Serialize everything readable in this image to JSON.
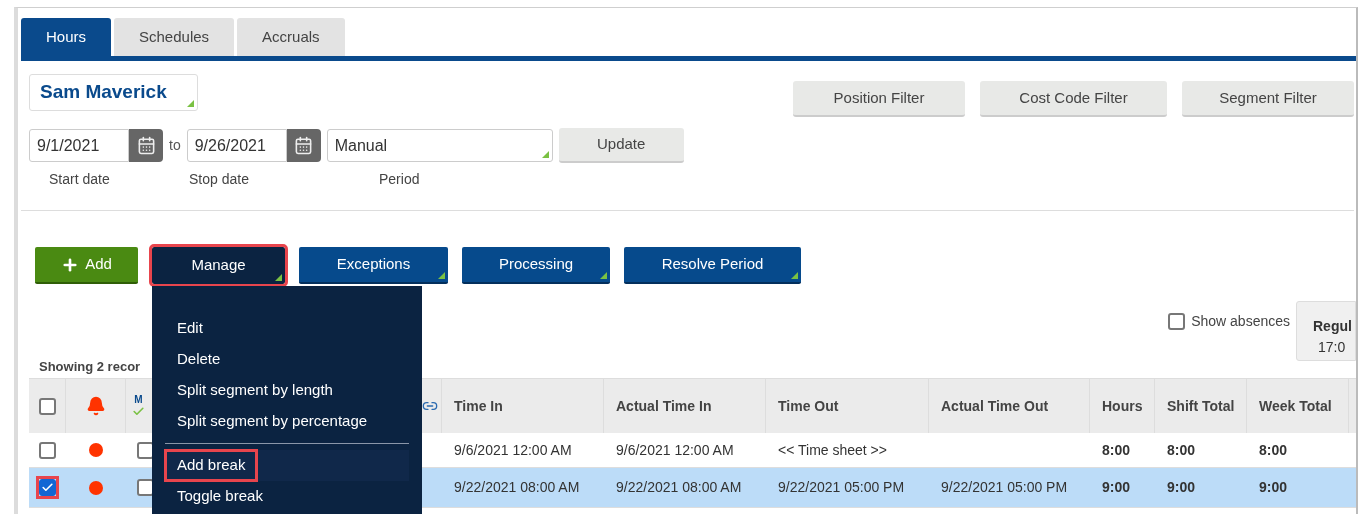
{
  "tabs": [
    {
      "label": "Hours",
      "selected": true
    },
    {
      "label": "Schedules",
      "selected": false
    },
    {
      "label": "Accruals",
      "selected": false
    }
  ],
  "employee": {
    "name": "Sam Maverick"
  },
  "filters": [
    "Position Filter",
    "Cost Code Filter",
    "Segment Filter"
  ],
  "range": {
    "start": "9/1/2021",
    "to": "to",
    "stop": "9/26/2021",
    "period": "Manual",
    "update": "Update",
    "start_label": "Start date",
    "stop_label": "Stop date",
    "period_label": "Period"
  },
  "actions": [
    {
      "label": "Add",
      "kind": "add",
      "dropdown": false,
      "highlighted": false
    },
    {
      "label": "Manage",
      "kind": "dark",
      "dropdown": true,
      "highlighted": true
    },
    {
      "label": "Exceptions",
      "kind": "blue",
      "dropdown": true,
      "highlighted": false
    },
    {
      "label": "Processing",
      "kind": "blue",
      "dropdown": true,
      "highlighted": false
    },
    {
      "label": "Resolve Period",
      "kind": "blue",
      "dropdown": true,
      "highlighted": false
    }
  ],
  "menu": [
    {
      "label": "Edit",
      "highlighted": false,
      "divider_before": false
    },
    {
      "label": "Delete",
      "highlighted": false,
      "divider_before": false
    },
    {
      "label": "Split segment by length",
      "highlighted": false,
      "divider_before": false
    },
    {
      "label": "Split segment by percentage",
      "highlighted": false,
      "divider_before": false
    },
    {
      "label": "Add break",
      "highlighted": true,
      "divider_before": true
    },
    {
      "label": "Toggle break",
      "highlighted": false,
      "divider_before": false
    }
  ],
  "show_absences": {
    "label": "Show absences",
    "checked": false
  },
  "summary": {
    "title": "Regul",
    "value": "17:0"
  },
  "record_count": "Showing 2 recor",
  "table": {
    "header_checked": false,
    "approve_label": "M",
    "columns": [
      "Time In",
      "Actual Time In",
      "Time Out",
      "Actual Time Out",
      "Hours",
      "Shift Total",
      "Week Total"
    ],
    "rows": [
      {
        "checked": false,
        "highlighted": false,
        "selected": false,
        "color": "#ff3300",
        "approved": false,
        "cells": [
          "9/6/2021 12:00 AM",
          "9/6/2021 12:00 AM",
          "<< Time sheet >>",
          "",
          "8:00",
          "8:00",
          "8:00"
        ]
      },
      {
        "checked": true,
        "highlighted": true,
        "selected": true,
        "color": "#ff3300",
        "approved": false,
        "cells": [
          "9/22/2021 08:00 AM",
          "9/22/2021 08:00 AM",
          "9/22/2021 05:00 PM",
          "9/22/2021 05:00 PM",
          "9:00",
          "9:00",
          "9:00"
        ]
      }
    ]
  }
}
